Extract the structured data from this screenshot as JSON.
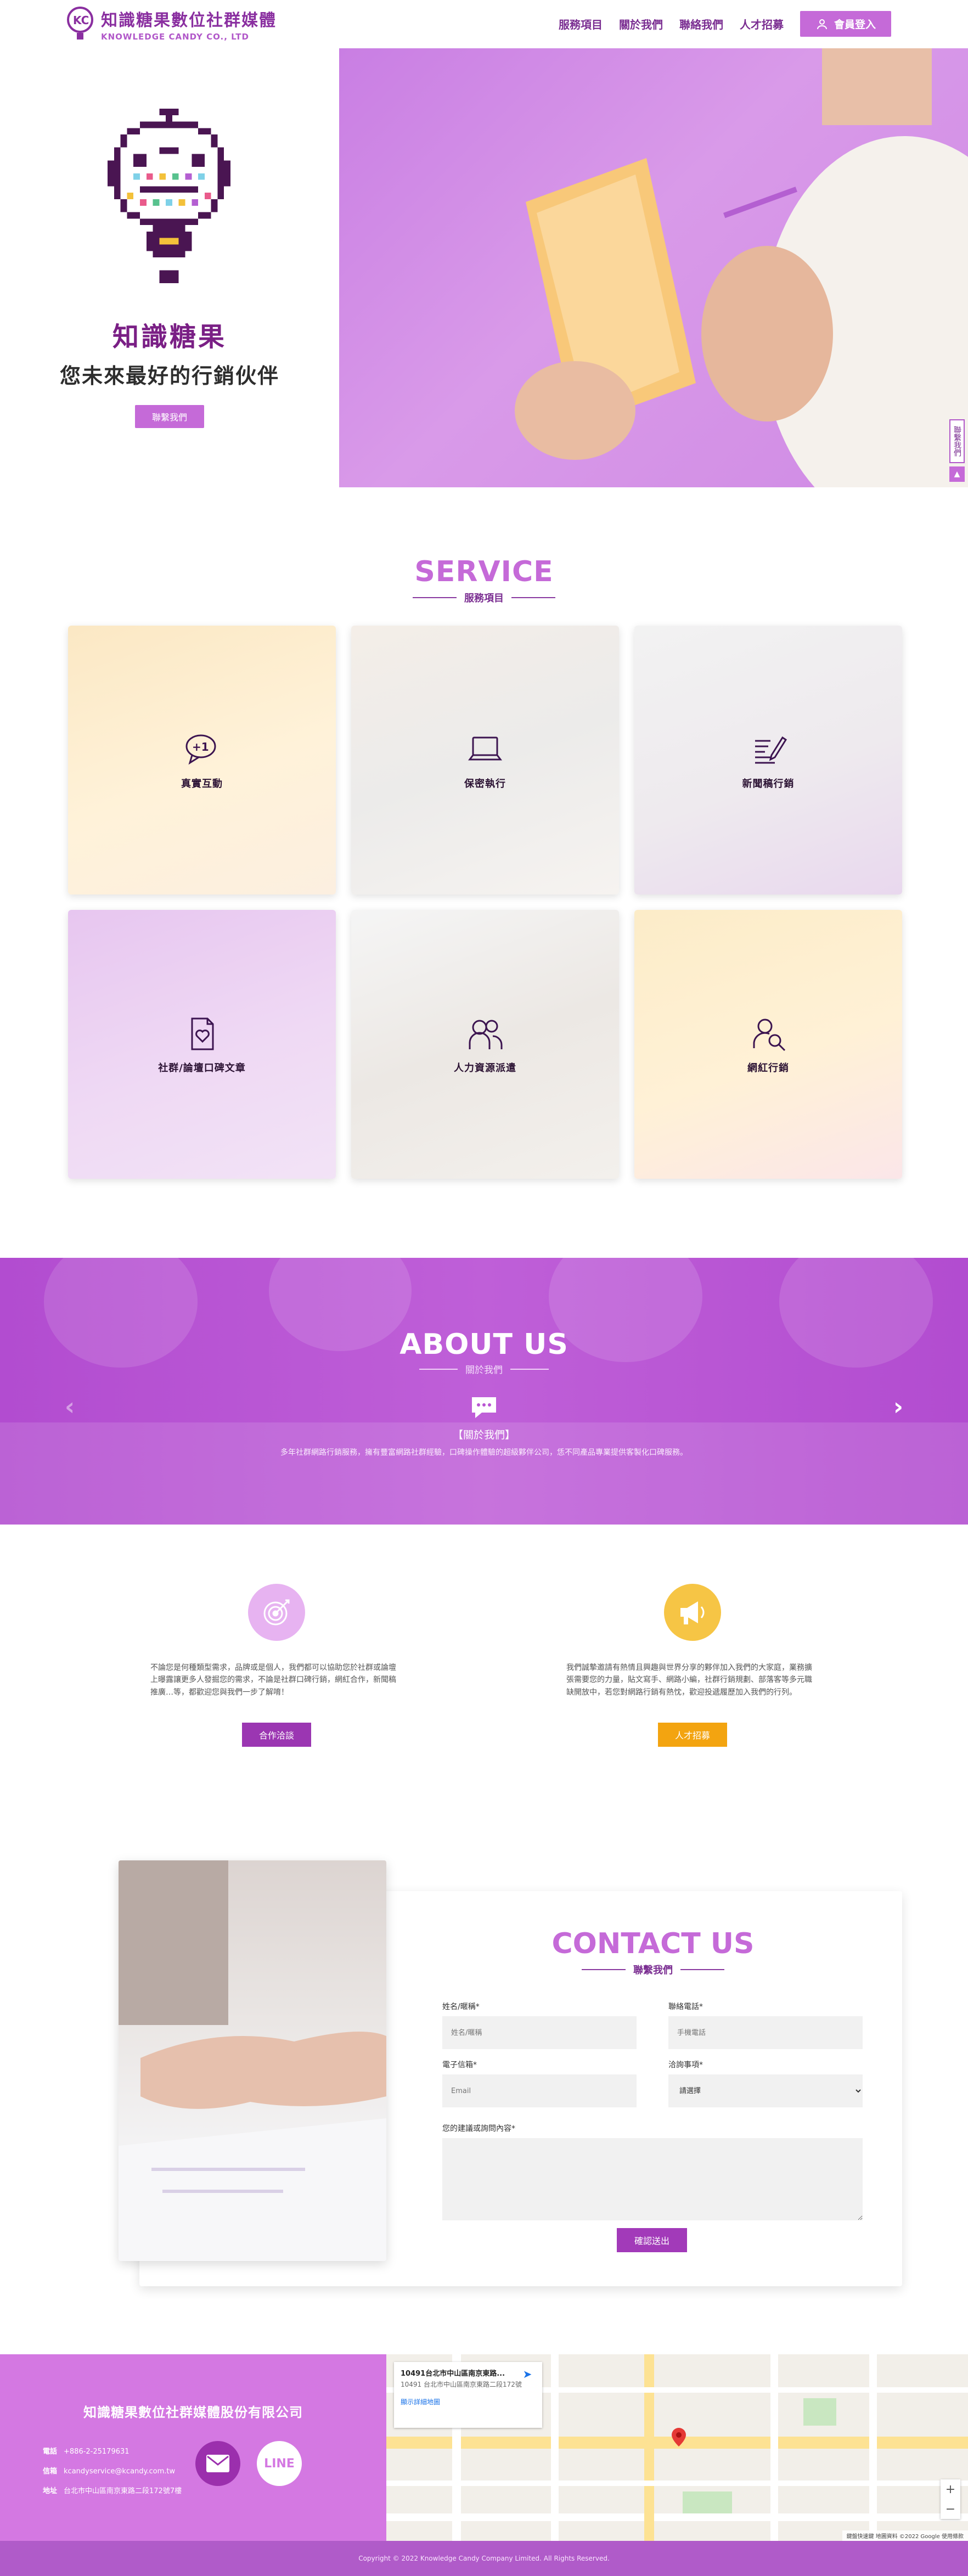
{
  "header": {
    "logo_cn": "知識糖果數位社群媒體",
    "logo_en": "KNOWLEDGE CANDY CO., LTD",
    "nav": [
      "服務項目",
      "關於我們",
      "聯絡我們",
      "人才招募"
    ],
    "member_label": "會員登入"
  },
  "hero": {
    "title": "知識糖果",
    "subtitle": "您未來最好的行銷伙伴",
    "button": "聯繫我們",
    "side_contact": "聯繫我們",
    "to_top": "▲"
  },
  "service": {
    "title_en": "SERVICE",
    "title_cn": "服務項目",
    "items": [
      {
        "label": "真實互動",
        "icon": "chat-plus-one-icon"
      },
      {
        "label": "保密執行",
        "icon": "laptop-icon"
      },
      {
        "label": "新聞稿行銷",
        "icon": "document-pen-icon"
      },
      {
        "label": "社群/論壇口碑文章",
        "icon": "heart-document-icon"
      },
      {
        "label": "人力資源派遣",
        "icon": "people-icon"
      },
      {
        "label": "網紅行銷",
        "icon": "influencer-search-icon"
      }
    ]
  },
  "about": {
    "title_en": "ABOUT US",
    "title_cn": "關於我們",
    "label": "【關於我們】",
    "desc": "多年社群網路行銷服務，擁有豐富網路社群經驗，口碑操作體驗的超級夥伴公司，恁不同產品專業提供客製化口碑服務。",
    "prev": "‹",
    "next": "›"
  },
  "cta": {
    "partner": {
      "text": "不論您是何種類型需求，品牌或是個人，我們都可以協助您於社群或論壇上曝露讓更多人發掘您的需求，不論是社群口碑行銷，網紅合作，新聞稿推廣…等，都歡迎您與我們一步了解唷！",
      "button": "合作洽談",
      "icon": "target-icon"
    },
    "recruit": {
      "text": "我們誠摯邀請有熱情且興趣與世界分享的夥伴加入我們的大家庭，業務擴張需要您的力量，貼文寫手、網路小編，社群行銷規劃、部落客等多元職缺開放中，若您對網路行銷有熱忱，歡迎投遞履歷加入我們的行列。",
      "button": "人才招募",
      "icon": "megaphone-icon"
    }
  },
  "contact": {
    "title_en": "CONTACT US",
    "title_cn": "聯繫我們",
    "name_label": "姓名/暱稱*",
    "name_placeholder": "姓名/暱稱",
    "phone_label": "聯絡電話*",
    "phone_placeholder": "手機電話",
    "email_label": "電子信箱*",
    "email_placeholder": "Email",
    "item_label": "洽詢事項*",
    "item_value": "請選擇",
    "msg_label": "您的建議或詢問內容*",
    "submit": "確認送出"
  },
  "footer": {
    "company": "知識糖果數位社群媒體股份有限公司",
    "phone_label": "電話",
    "phone": "+886-2-25179631",
    "email_label": "信箱",
    "email": "kcandyservice@kcandy.com.tw",
    "address_label": "地址",
    "address": "台北市中山區南京東路二段172號7樓",
    "line_label": "LINE",
    "copyright": "Copyright © 2022 Knowledge Candy Company Limited. All Rights Reserved."
  },
  "map": {
    "title": "10491台北市中山區南京東路...",
    "address": "10491 台北市中山區南京東路二段172號",
    "link": "顯示詳細地圖",
    "directions": "路線",
    "footer": "鍵盤快速鍵  地圖資料 ©2022 Google  使用條款",
    "zoom_in": "+",
    "zoom_out": "−"
  },
  "colors": {
    "brand_purple": "#c56ad8",
    "deep_purple": "#7a2d91",
    "about_bg": "#b955d3",
    "gold": "#f3a410"
  }
}
